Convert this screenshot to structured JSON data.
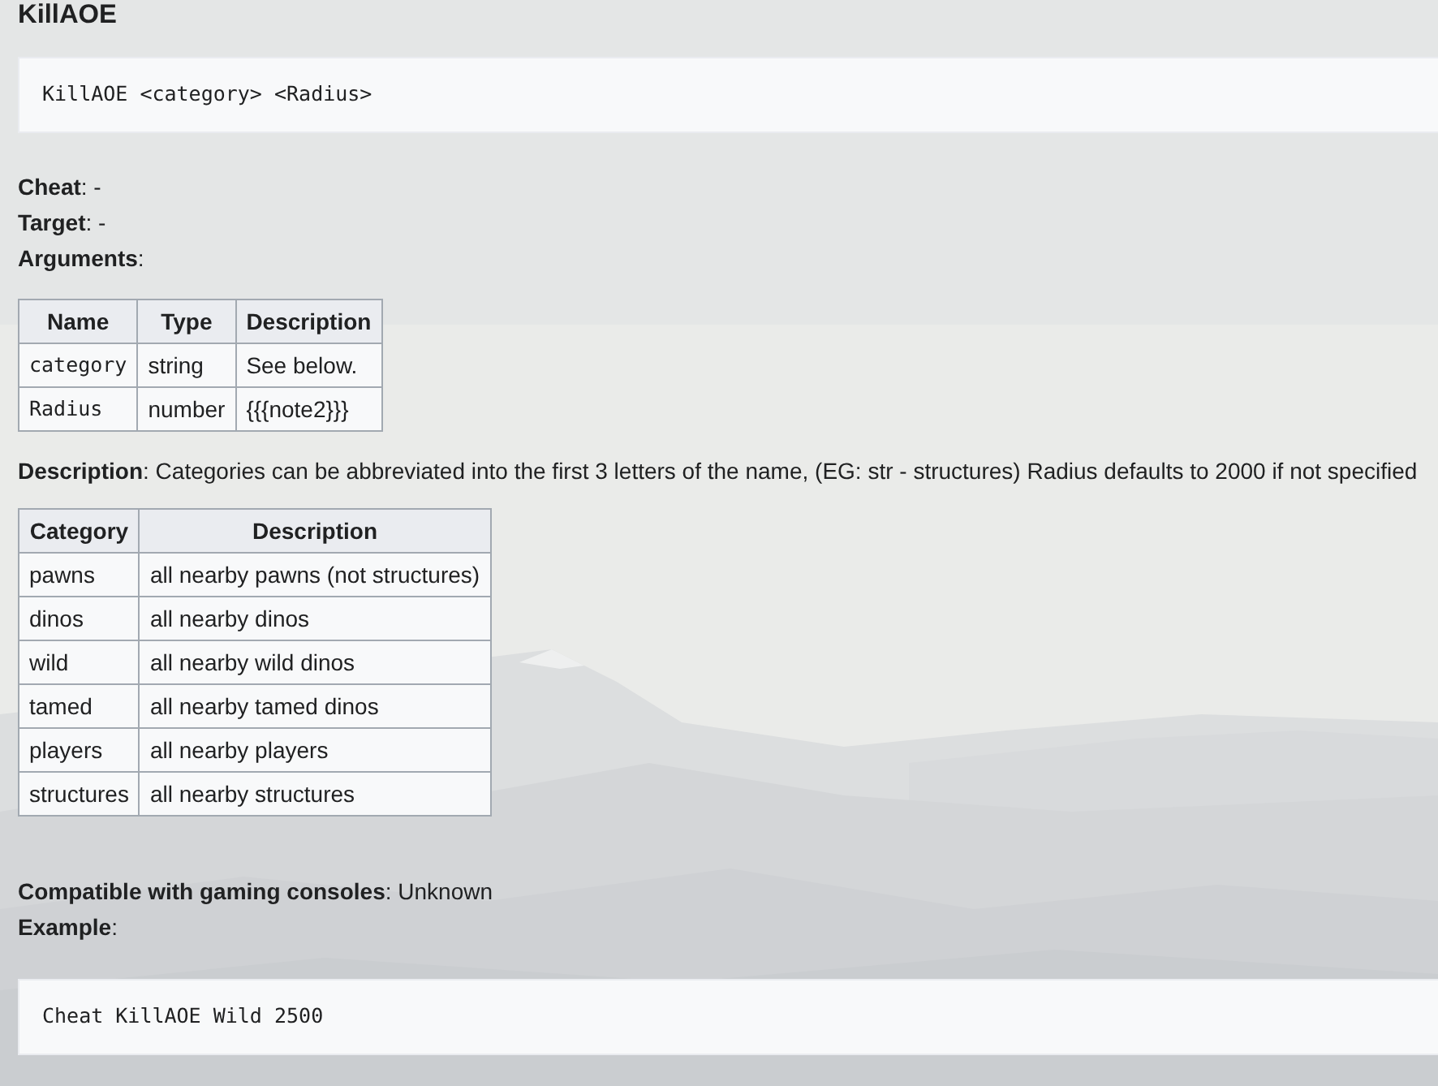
{
  "heading": "KillAOE",
  "syntax": "KillAOE <category> <Radius>",
  "fields": [
    "**Cheat**: -",
    "**Target**: -",
    "**Arguments**:"
  ],
  "arguments_table": {
    "columns": [
      "Name",
      "Type",
      "Description"
    ],
    "rows": [
      {
        "name": "category",
        "type": "string",
        "description": "See below."
      },
      {
        "name": "Radius",
        "type": "number",
        "description": "{{{note2}}}"
      }
    ]
  },
  "description": "**Description**: Categories can be abbreviated into the first 3 letters of the name, (EG: str - structures) Radius defaults to 2000 if not specified",
  "categories_table": {
    "columns": [
      "Category",
      "Description"
    ],
    "rows": [
      {
        "category": "pawns",
        "description": "all nearby pawns (not structures)"
      },
      {
        "category": "dinos",
        "description": "all nearby dinos"
      },
      {
        "category": "wild",
        "description": "all nearby wild dinos"
      },
      {
        "category": "tamed",
        "description": "all nearby tamed dinos"
      },
      {
        "category": "players",
        "description": "all nearby players"
      },
      {
        "category": "structures",
        "description": "all nearby structures"
      }
    ]
  },
  "footer_fields": [
    "**Compatible with gaming consoles**: Unknown",
    "**Example**:"
  ],
  "example": "Cheat KillAOE Wild 2500"
}
